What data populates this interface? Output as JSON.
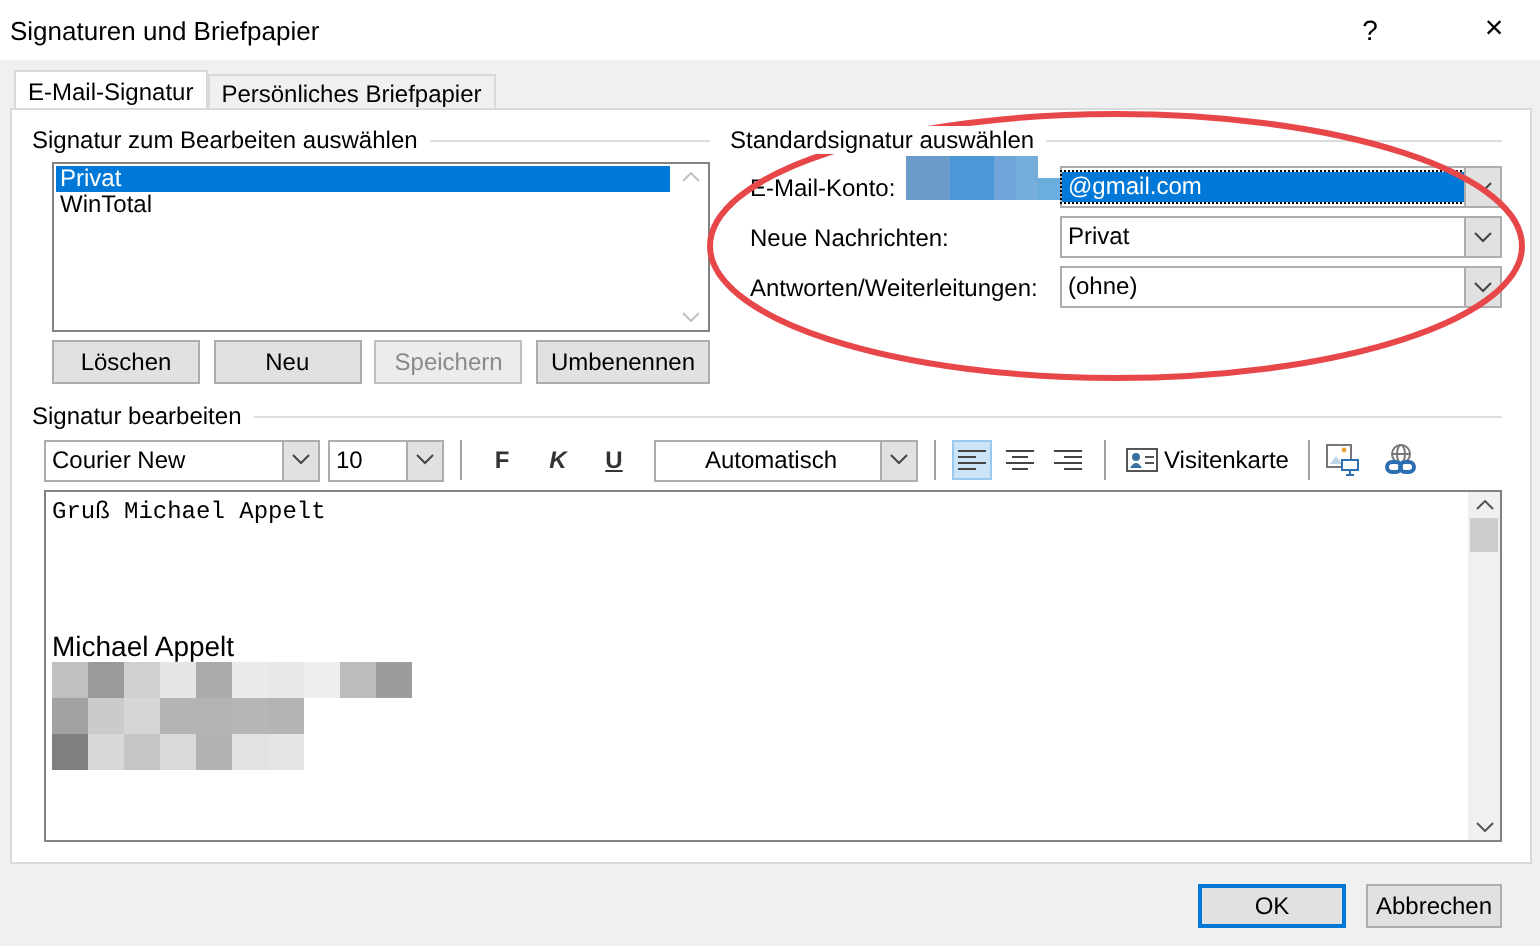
{
  "window": {
    "title": "Signaturen und Briefpapier",
    "help": "?",
    "close": "×"
  },
  "tabs": [
    {
      "label": "E-Mail-Signatur",
      "selected": true
    },
    {
      "label": "Persönliches Briefpapier",
      "selected": false
    }
  ],
  "signature_select": {
    "title": "Signatur zum Bearbeiten auswählen",
    "items": [
      {
        "label": "Privat",
        "selected": true
      },
      {
        "label": "WinTotal",
        "selected": false
      }
    ],
    "buttons": [
      {
        "label": "Löschen",
        "disabled": false
      },
      {
        "label": "Neu",
        "disabled": false
      },
      {
        "label": "Speichern",
        "disabled": true
      },
      {
        "label": "Umbenennen",
        "disabled": false
      }
    ]
  },
  "default_signature": {
    "title": "Standardsignatur auswählen",
    "fields": [
      {
        "label": "E-Mail-Konto:",
        "value": "@gmail.com",
        "highlighted": true,
        "redacted": true
      },
      {
        "label": "Neue Nachrichten:",
        "value": "Privat",
        "highlighted": false,
        "redacted": false
      },
      {
        "label": "Antworten/Weiterleitungen:",
        "value": "(ohne)",
        "highlighted": false,
        "redacted": false
      }
    ]
  },
  "editor": {
    "title": "Signatur bearbeiten",
    "font": "Courier New",
    "size": "10",
    "format_buttons": [
      {
        "kind": "bold",
        "label": "F"
      },
      {
        "kind": "italic",
        "label": "K"
      },
      {
        "kind": "underline",
        "label": "U"
      }
    ],
    "font_color": "Automatisch",
    "align": [
      {
        "kind": "left",
        "selected": true
      },
      {
        "kind": "center",
        "selected": false
      },
      {
        "kind": "right",
        "selected": false
      }
    ],
    "business_card": "Visitenkarte",
    "lines": [
      {
        "kind": "mono",
        "text": "Gruß Michael Appelt"
      },
      {
        "kind": "sans",
        "text": "Michael Appelt"
      }
    ]
  },
  "buttons": [
    {
      "label": "OK",
      "default": true
    },
    {
      "label": "Abbrechen",
      "default": false
    }
  ]
}
